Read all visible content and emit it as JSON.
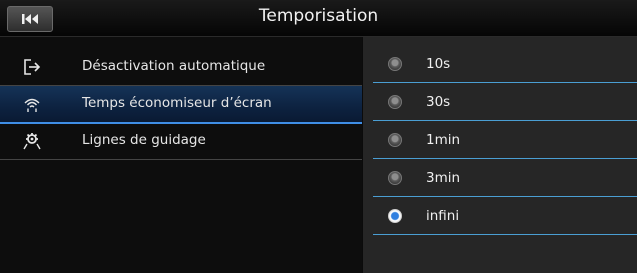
{
  "header": {
    "title": "Temporisation",
    "back_icon": "skip-back-icon"
  },
  "menu": {
    "items": [
      {
        "label": "Désactivation automatique",
        "icon": "exit-door-icon",
        "active": false
      },
      {
        "label": "Temps économiseur d’écran",
        "icon": "signal-screensaver-icon",
        "active": true
      },
      {
        "label": "Lignes de guidage",
        "icon": "guidelines-car-icon",
        "active": false
      }
    ]
  },
  "options": {
    "items": [
      {
        "label": "10s",
        "selected": false
      },
      {
        "label": "30s",
        "selected": false
      },
      {
        "label": "1min",
        "selected": false
      },
      {
        "label": "3min",
        "selected": false
      },
      {
        "label": "infini",
        "selected": true
      }
    ]
  },
  "colors": {
    "accent": "#3f8ee6",
    "selected_radio": "#2f7fe0",
    "divider": "#4a9ed3"
  }
}
